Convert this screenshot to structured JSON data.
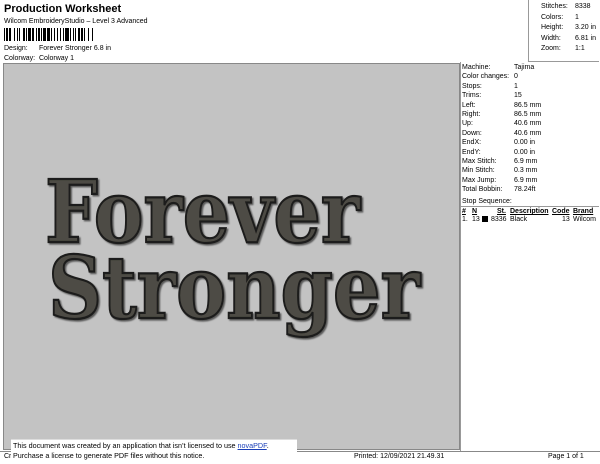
{
  "header": {
    "title": "Production Worksheet",
    "subtitle": "Wilcom EmbroideryStudio – Level 3 Advanced",
    "design_label": "Design:",
    "design_value": "Forever Stronger 6.8 in",
    "colorway_label": "Colorway:",
    "colorway_value": "Colorway 1"
  },
  "stats": [
    {
      "label": "Stitches:",
      "value": "8338"
    },
    {
      "label": "Colors:",
      "value": "1"
    },
    {
      "label": "Height:",
      "value": "3.20 in"
    },
    {
      "label": "Width:",
      "value": "6.81 in"
    },
    {
      "label": "Zoom:",
      "value": "1:1"
    }
  ],
  "design_text": {
    "line1": "Forever",
    "line2": "Stronger",
    "thread_color": "#4e4c45",
    "canvas_color": "#c3c3c3"
  },
  "machine_info": [
    {
      "label": "Machine:",
      "value": "Tajima"
    },
    {
      "label": "Color changes:",
      "value": "0"
    },
    {
      "label": "Stops:",
      "value": "1"
    },
    {
      "label": "Trims:",
      "value": "15"
    },
    {
      "label": "Left:",
      "value": "86.5 mm"
    },
    {
      "label": "Right:",
      "value": "86.5 mm"
    },
    {
      "label": "Up:",
      "value": "40.6 mm"
    },
    {
      "label": "Down:",
      "value": "40.6 mm"
    },
    {
      "label": "EndX:",
      "value": "0.00 in"
    },
    {
      "label": "EndY:",
      "value": "0.00 in"
    },
    {
      "label": "Max Stitch:",
      "value": "6.9 mm"
    },
    {
      "label": "Min Stitch:",
      "value": "0.3 mm"
    },
    {
      "label": "Max Jump:",
      "value": "6.9 mm"
    },
    {
      "label": "Total Bobbin:",
      "value": "78.24ft"
    }
  ],
  "stop_sequence": {
    "title": "Stop Sequence:",
    "columns": [
      "#",
      "N",
      "St.",
      "Description",
      "Code",
      "Brand"
    ],
    "rows": [
      {
        "index": "1.",
        "n": "13",
        "stitches": "8336",
        "description": "Black",
        "code": "13",
        "brand": "Wilcom",
        "color": "#000000"
      }
    ]
  },
  "footer": {
    "left": "Cr",
    "printed": "Printed: 12/09/2021 21.49.31",
    "page": "Page 1 of 1"
  },
  "notice": {
    "line1_prefix": "This document was created by an application that isn’t licensed to use ",
    "link": "novaPDF",
    "line1_suffix": ".",
    "line2": "Purchase a license to generate PDF files without this notice."
  }
}
